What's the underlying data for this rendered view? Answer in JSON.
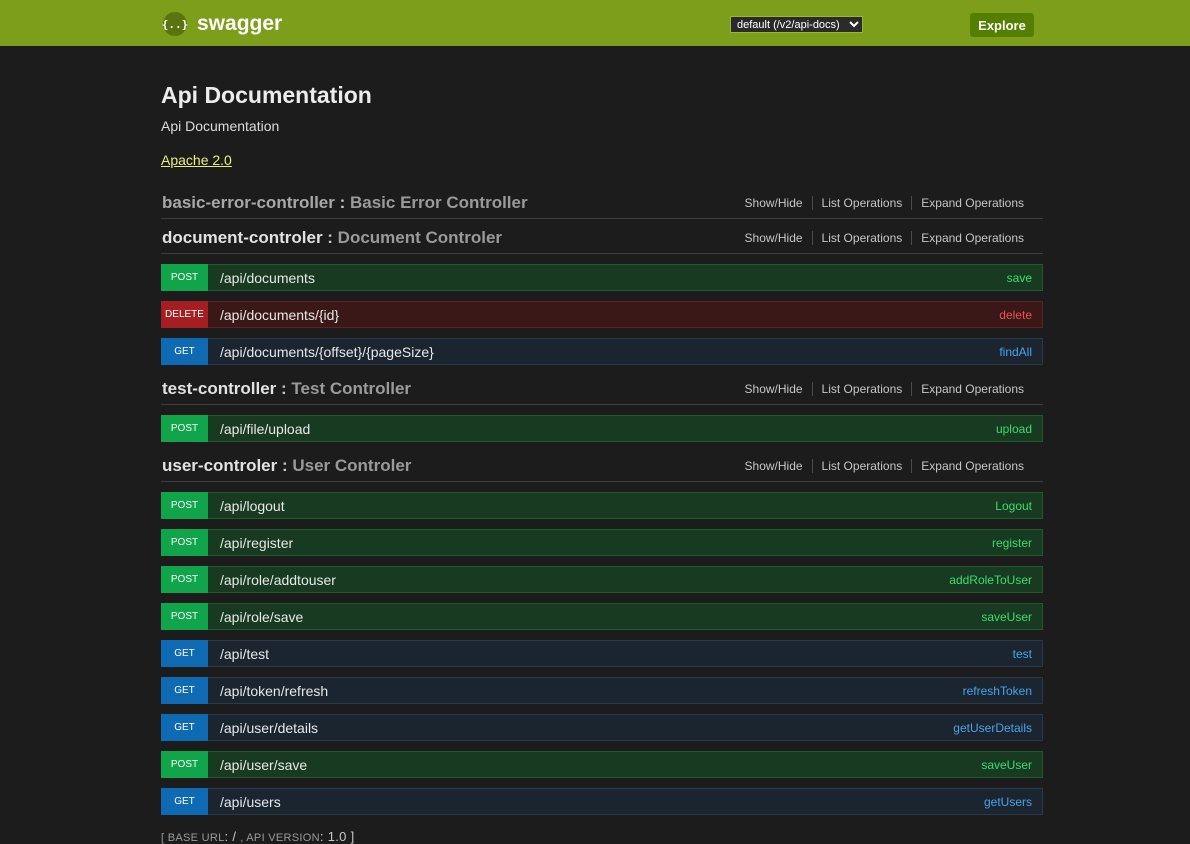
{
  "header": {
    "logo_glyph": "{..}",
    "logo_text": "swagger",
    "api_select": "default (/v2/api-docs)",
    "explore_label": "Explore"
  },
  "info": {
    "title": "Api Documentation",
    "description": "Api Documentation",
    "license": "Apache 2.0"
  },
  "op_links": [
    "Show/Hide",
    "List Operations",
    "Expand Operations"
  ],
  "resources": [
    {
      "name": "basic-error-controller",
      "sep": " : ",
      "desc": "Basic Error Controller",
      "muted": true,
      "operations": []
    },
    {
      "name": "document-controler",
      "sep": " : ",
      "desc": "Document Controler",
      "operations": [
        {
          "method": "POST",
          "path": "/api/documents",
          "nickname": "save"
        },
        {
          "method": "DELETE",
          "path": "/api/documents/{id}",
          "nickname": "delete"
        },
        {
          "method": "GET",
          "path": "/api/documents/{offset}/{pageSize}",
          "nickname": "findAll"
        }
      ]
    },
    {
      "name": "test-controller",
      "sep": " : ",
      "desc": "Test Controller",
      "operations": [
        {
          "method": "POST",
          "path": "/api/file/upload",
          "nickname": "upload"
        }
      ]
    },
    {
      "name": "user-controler",
      "sep": " : ",
      "desc": "User Controler",
      "operations": [
        {
          "method": "POST",
          "path": "/api/logout",
          "nickname": "Logout"
        },
        {
          "method": "POST",
          "path": "/api/register",
          "nickname": "register"
        },
        {
          "method": "POST",
          "path": "/api/role/addtouser",
          "nickname": "addRoleToUser"
        },
        {
          "method": "POST",
          "path": "/api/role/save",
          "nickname": "saveUser"
        },
        {
          "method": "GET",
          "path": "/api/test",
          "nickname": "test"
        },
        {
          "method": "GET",
          "path": "/api/token/refresh",
          "nickname": "refreshToken"
        },
        {
          "method": "GET",
          "path": "/api/user/details",
          "nickname": "getUserDetails"
        },
        {
          "method": "POST",
          "path": "/api/user/save",
          "nickname": "saveUser"
        },
        {
          "method": "GET",
          "path": "/api/users",
          "nickname": "getUsers"
        }
      ]
    }
  ],
  "footer": {
    "open": "[ ",
    "base_label": "BASE URL",
    "base_value": ": / ",
    "version_label": ", API VERSION",
    "version_value": ": 1.0 ",
    "close": "]"
  },
  "colors": {
    "topbar": "#7d9e1a",
    "background": "#1c1c1c",
    "post": "#10a54a",
    "get": "#0f6ab4",
    "delete": "#a41e22",
    "link": "#e6f07c"
  }
}
